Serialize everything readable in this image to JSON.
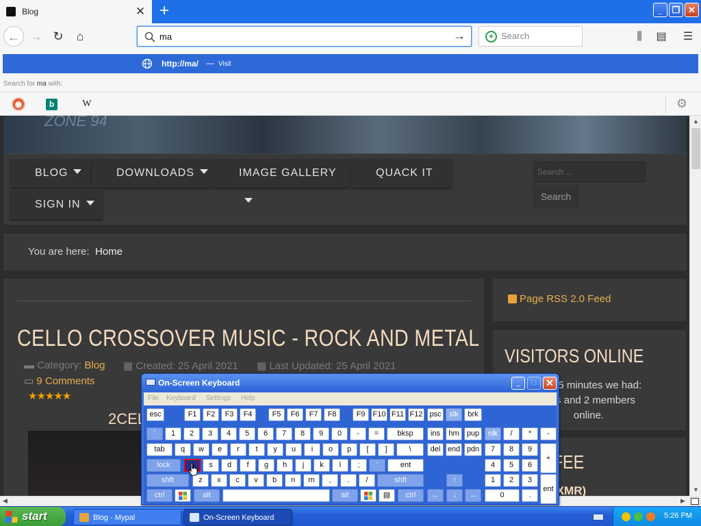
{
  "browser": {
    "tab": {
      "title": "Blog",
      "close_glyph": "✕",
      "new_tab_glyph": "+"
    },
    "url_input": "ma",
    "search_placeholder": "Search",
    "suggestion": {
      "url": "http://ma/",
      "separator": "—",
      "action": "Visit"
    },
    "search_with": {
      "prefix": "Search for",
      "term": "ma",
      "suffix": "with:"
    },
    "engines": {
      "wiki_glyph": "W",
      "bing_glyph": "b"
    }
  },
  "site": {
    "banner_logo": "ZONE 94",
    "nav": [
      {
        "label": "BLOG",
        "has_caret": true
      },
      {
        "label": "DOWNLOADS",
        "has_caret": true
      },
      {
        "label": "IMAGE GALLERY",
        "has_caret": true
      },
      {
        "label": "QUACK IT",
        "has_caret": false
      },
      {
        "label": "SIGN IN",
        "has_caret": true
      }
    ],
    "search_placeholder": "Search ...",
    "search_button": "Search",
    "breadcrumb": {
      "label": "You are here:",
      "home": "Home"
    },
    "article": {
      "title": "CELLO CROSSOVER MUSIC - ROCK AND METAL",
      "category_label": "Category:",
      "category": "Blog",
      "created": "Created: 25 April 2021",
      "updated": "Last Updated: 25 April 2021",
      "comments": "9 Comments",
      "rating": 5,
      "stars_glyph": "★★★★★",
      "subheading": "2CELL"
    },
    "rss": "Page RSS 2.0 Feed",
    "visitors": {
      "title": "VISITORS ONLINE",
      "line1": "ast 15 minutes we had:",
      "line2": "ests and 2 members",
      "line3": "online."
    },
    "coffee": {
      "title": "A COFFEE",
      "sub": "ONERO (XMR)"
    }
  },
  "osk": {
    "title": "On-Screen Keyboard",
    "menu": [
      "File",
      "Keyboard",
      "Settings",
      "Help"
    ],
    "rows": [
      [
        "esc",
        "F1",
        "F2",
        "F3",
        "F4",
        "F5",
        "F6",
        "F7",
        "F8",
        "F9",
        "F10",
        "F11",
        "F12",
        "psc",
        "slk",
        "brk"
      ],
      [
        "`",
        "1",
        "2",
        "3",
        "4",
        "5",
        "6",
        "7",
        "8",
        "9",
        "0",
        "-",
        "=",
        "bksp",
        "ins",
        "hm",
        "pup",
        "nlk",
        "/",
        "*",
        "-"
      ],
      [
        "tab",
        "q",
        "w",
        "e",
        "r",
        "t",
        "y",
        "u",
        "i",
        "o",
        "p",
        "[",
        "]",
        "\\",
        "del",
        "end",
        "pdn",
        "7",
        "8",
        "9",
        "+"
      ],
      [
        "lock",
        "a",
        "s",
        "d",
        "f",
        "g",
        "h",
        "j",
        "k",
        "l",
        ";",
        "'",
        "ent",
        "4",
        "5",
        "6"
      ],
      [
        "shft",
        "z",
        "x",
        "c",
        "v",
        "b",
        "n",
        "m",
        ",",
        ".",
        "/",
        "shft",
        "↑",
        "1",
        "2",
        "3",
        "ent"
      ],
      [
        "ctrl",
        "alt",
        "alt",
        "ctrl",
        "←",
        "↓",
        "→",
        "0",
        "."
      ]
    ]
  },
  "taskbar": {
    "start": "start",
    "tasks": [
      "Blog - Mypal",
      "On-Screen Keyboard"
    ],
    "clock": "5:26 PM"
  }
}
